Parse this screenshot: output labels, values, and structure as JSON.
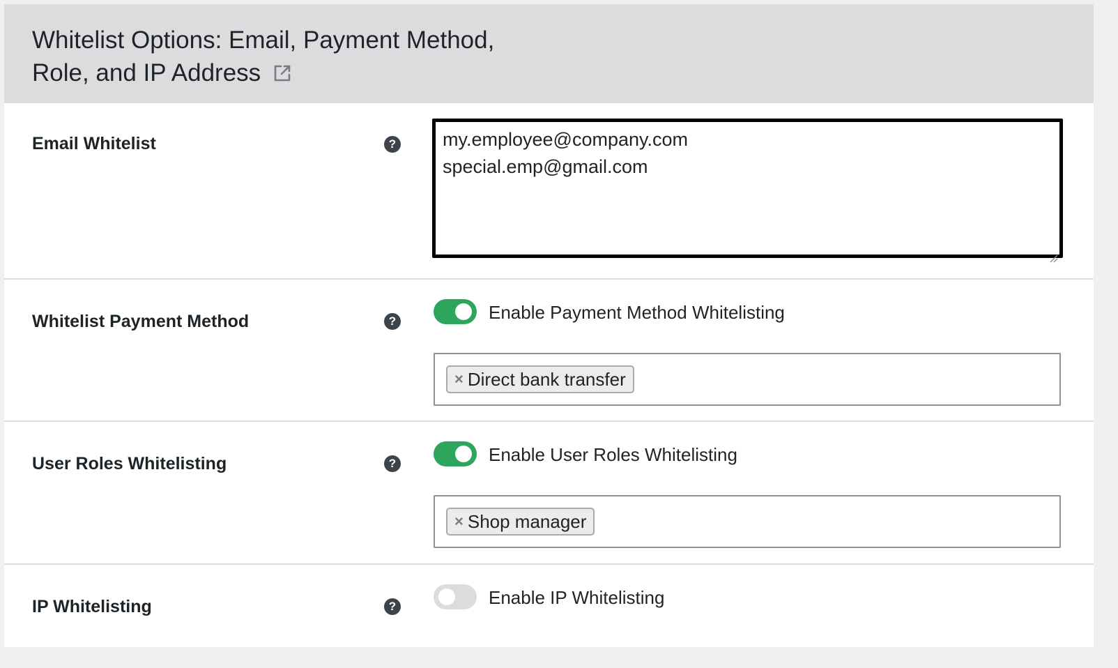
{
  "header": {
    "title": "Whitelist Options: Email, Payment Method, Role, and IP Address",
    "link_icon": "external-link-icon"
  },
  "email_whitelist": {
    "label": "Email Whitelist",
    "help_icon": "question-circle-icon",
    "help_glyph": "?",
    "lines": [
      "my.employee@company.com",
      "special.emp@gmail.com"
    ]
  },
  "payment_method": {
    "label": "Whitelist Payment Method",
    "help_glyph": "?",
    "toggle_label": "Enable Payment Method Whitelisting",
    "toggle_on": true,
    "chips": [
      {
        "remove": "×",
        "label": "Direct bank transfer"
      }
    ]
  },
  "user_roles": {
    "label": "User Roles Whitelisting",
    "help_glyph": "?",
    "toggle_label": "Enable User Roles Whitelisting",
    "toggle_on": true,
    "chips": [
      {
        "remove": "×",
        "label": "Shop manager"
      }
    ]
  },
  "ip_whitelist": {
    "label": "IP Whitelisting",
    "help_glyph": "?",
    "toggle_label": "Enable IP Whitelisting",
    "toggle_on": false
  },
  "colors": {
    "toggle_on": "#2ea55d",
    "toggle_off": "#dcdcde",
    "header_bg": "#dcdcde"
  }
}
